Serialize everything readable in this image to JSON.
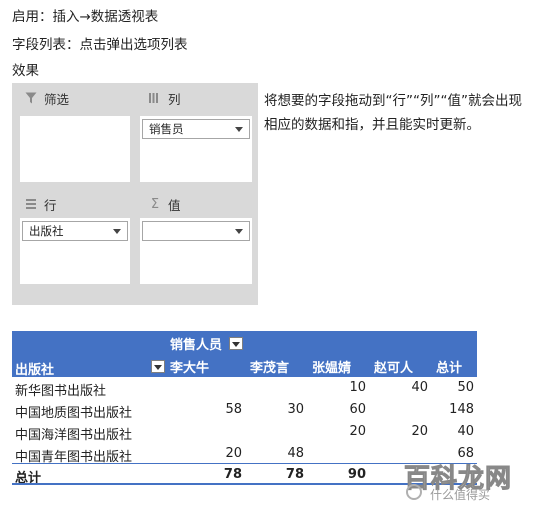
{
  "intro": {
    "line1": "启用：插入→数据透视表",
    "line2": "字段列表：点击弹出选项列表",
    "line3": "效果"
  },
  "areas": {
    "filter": {
      "label": "筛选",
      "icon": "filter-icon"
    },
    "columns": {
      "label": "列",
      "icon": "columns-icon",
      "field": "销售员"
    },
    "rows": {
      "label": "行",
      "icon": "rows-icon",
      "field": "出版社"
    },
    "values": {
      "label": "值",
      "icon": "sigma-icon",
      "field": ""
    }
  },
  "description": "将想要的字段拖动到“行”“列”“值”就会出现相应的数据和指，并且能实时更新。",
  "pivot": {
    "col_field": "销售人员",
    "row_field": "出版社",
    "columns": [
      "李大牛",
      "李茂言",
      "张媪婧",
      "赵可人",
      "总计"
    ],
    "rows": [
      {
        "name": "新华图书出版社",
        "values": [
          "",
          "",
          "10",
          "40",
          "50"
        ]
      },
      {
        "name": "中国地质图书出版社",
        "values": [
          "58",
          "30",
          "60",
          "",
          "148"
        ]
      },
      {
        "name": "中国海洋图书出版社",
        "values": [
          "",
          "",
          "20",
          "20",
          "40"
        ]
      },
      {
        "name": "中国青年图书出版社",
        "values": [
          "20",
          "48",
          "",
          "",
          "68"
        ]
      }
    ],
    "total": {
      "name": "总计",
      "values": [
        "78",
        "78",
        "90",
        "",
        ""
      ]
    }
  },
  "watermark": {
    "big": "百科龙网",
    "small": "什么值得买"
  },
  "colors": {
    "accent": "#4472c4",
    "panel": "#d9d9d9"
  }
}
